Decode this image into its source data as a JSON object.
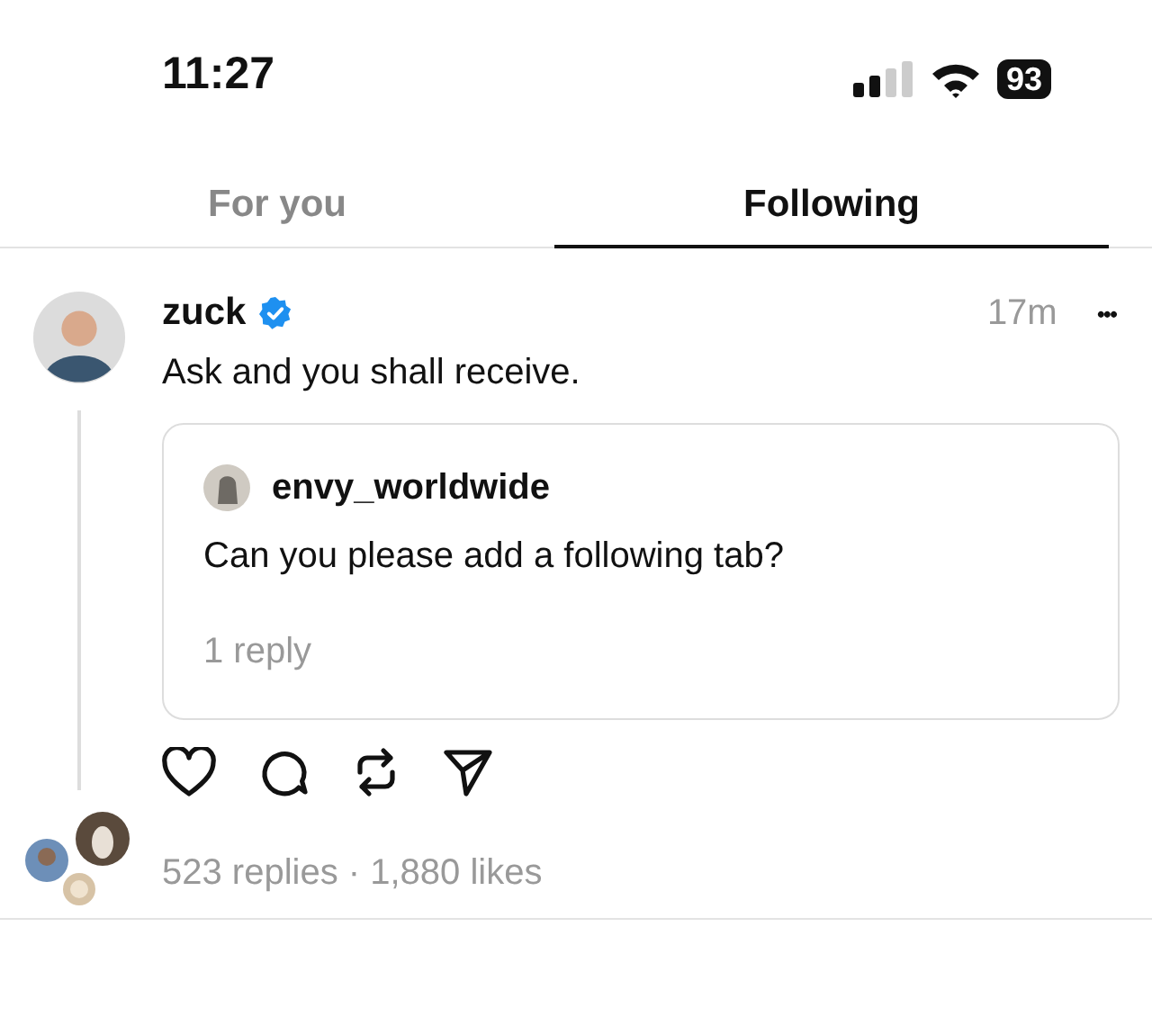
{
  "status_bar": {
    "time": "11:27",
    "battery": "93"
  },
  "tabs": [
    {
      "label": "For you",
      "selected": false
    },
    {
      "label": "Following",
      "selected": true
    }
  ],
  "post": {
    "author": "zuck",
    "verified": true,
    "time": "17m",
    "menu": "•••",
    "text": "Ask and you shall receive.",
    "quote": {
      "author": "envy_worldwide",
      "text": "Can you please add a following tab?",
      "replies": "1 reply"
    },
    "stats": "523 replies · 1,880 likes"
  }
}
